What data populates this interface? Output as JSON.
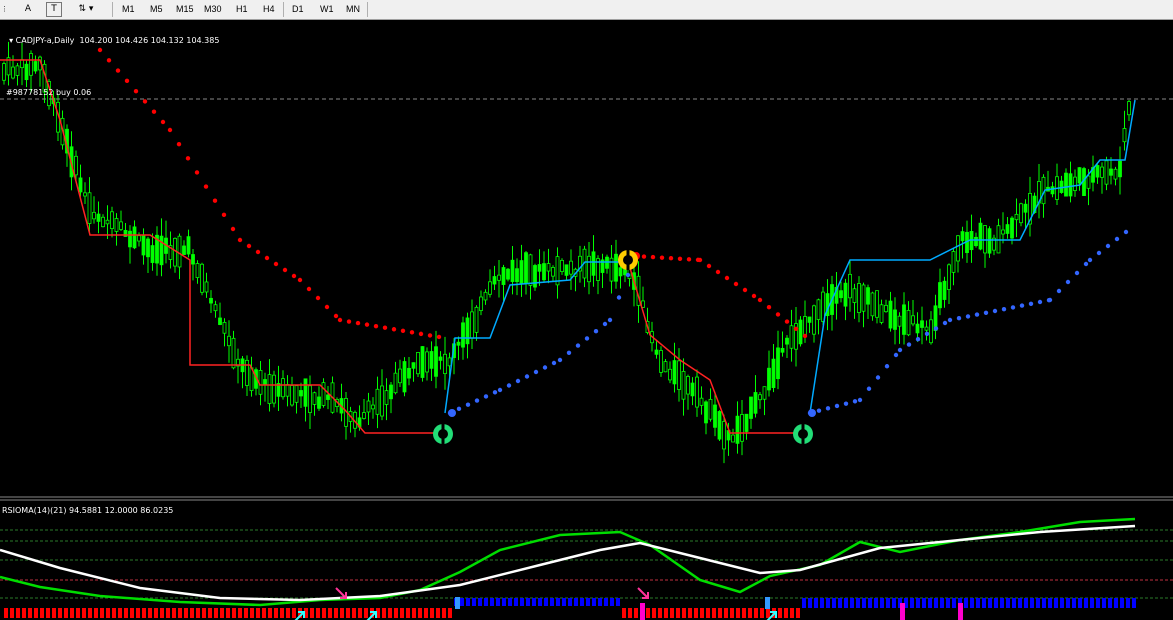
{
  "toolbar": {
    "tools": [
      "A",
      "T"
    ],
    "timeframes": [
      "M1",
      "M5",
      "M15",
      "M30",
      "H1",
      "H4",
      "D1",
      "W1",
      "MN"
    ]
  },
  "main": {
    "header": "CADJPY-a,Daily  104.200 104.426 104.132 104.385",
    "order_label": "#98778152 buy 0.06"
  },
  "indicator": {
    "header": "RSIOMA(14)(21) 94.5881 12.0000 86.0235"
  },
  "colors": {
    "candle": "#00ff00",
    "stop_down": "#ff0000",
    "stop_up": "#3366ff",
    "trend_up": "#00aaff",
    "trend_down": "#ff2222",
    "rsioma": "#00dd00",
    "signal": "#ffffff",
    "hist_bear": "#ff0000",
    "hist_bull": "#0000ff"
  },
  "chart_data": [
    {
      "type": "candlestick",
      "symbol": "CADJPY-a",
      "timeframe": "Daily",
      "ohlc_last": [
        104.2,
        104.426,
        104.132,
        104.385
      ],
      "order_line": {
        "ticket": "#98778152",
        "side": "buy",
        "lots": 0.06
      }
    },
    {
      "type": "line",
      "name": "RSIOMA",
      "params": [
        14,
        21
      ],
      "values_last": [
        94.5881,
        12.0,
        86.0235
      ]
    }
  ]
}
